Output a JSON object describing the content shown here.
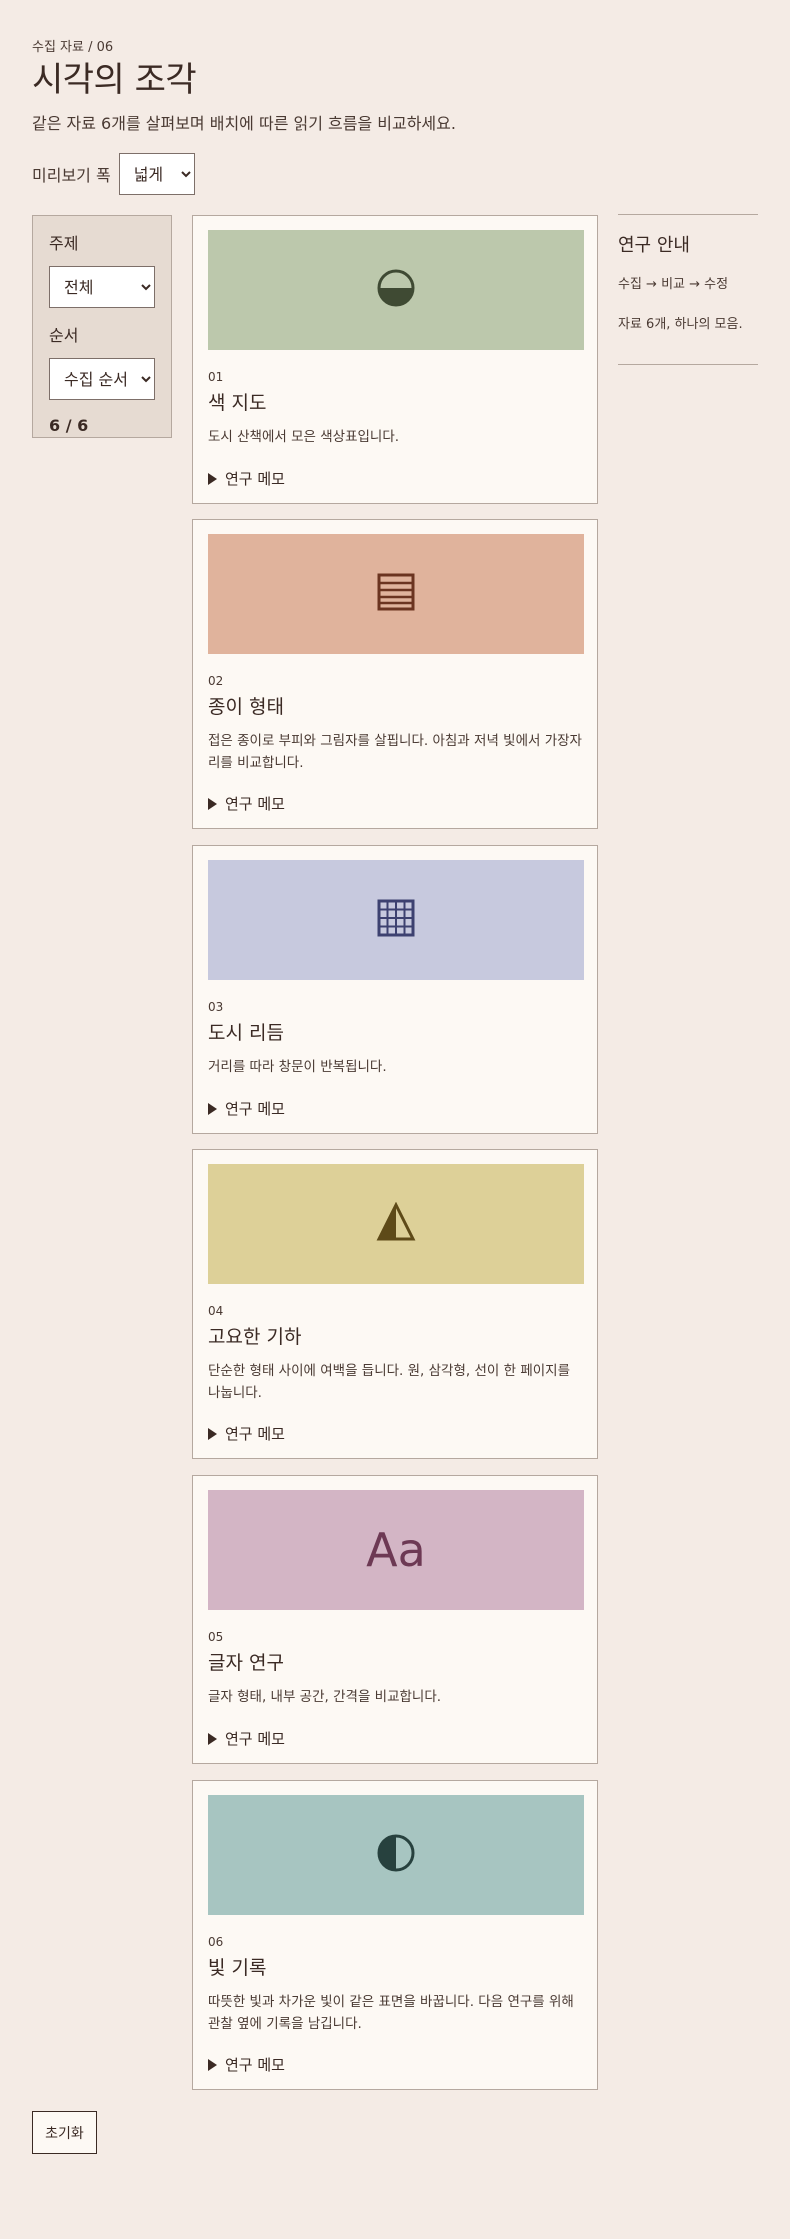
{
  "header": {
    "breadcrumb": "수집 자료 / 06",
    "title": "시각의 조각",
    "subtitle": "같은 자료 6개를 살펴보며 배치에 따른 읽기 흐름을 비교하세요."
  },
  "preview": {
    "label": "미리보기 폭",
    "selected": "넓게"
  },
  "filters": {
    "topic_label": "주제",
    "topic_selected": "전체",
    "order_label": "순서",
    "order_selected": "수집 순서",
    "count": "6 / 6"
  },
  "cards": [
    {
      "num": "01",
      "title": "색 지도",
      "desc": "도시 산책에서 모은 색상표입니다.",
      "memo": "연구 메모",
      "color": "#bcc8ac",
      "icon": "half-filled-circle-icon"
    },
    {
      "num": "02",
      "title": "종이 형태",
      "desc": "접은 종이로 부피와 그림자를 살핍니다. 아침과 저녁 빛에서 가장자리를 비교합니다.",
      "memo": "연구 메모",
      "color": "#e0b39c",
      "icon": "lined-square-icon"
    },
    {
      "num": "03",
      "title": "도시 리듬",
      "desc": "거리를 따라 창문이 반복됩니다.",
      "memo": "연구 메모",
      "color": "#c7c9de",
      "icon": "grid-square-icon"
    },
    {
      "num": "04",
      "title": "고요한 기하",
      "desc": "단순한 형태 사이에 여백을 듭니다. 원, 삼각형, 선이 한 페이지를 나눕니다.",
      "memo": "연구 메모",
      "color": "#ddd098",
      "icon": "half-triangle-icon"
    },
    {
      "num": "05",
      "title": "글자 연구",
      "desc": "글자 형태, 내부 공간, 간격을 비교합니다.",
      "memo": "연구 메모",
      "color": "#d3b5c5",
      "icon": "aa-glyph",
      "glyph": "Aa"
    },
    {
      "num": "06",
      "title": "빛 기록",
      "desc": "따뜻한 빛과 차가운 빛이 같은 표면을 바꿉니다. 다음 연구를 위해 관찰 옆에 기록을 남깁니다.",
      "memo": "연구 메모",
      "color": "#a7c5c1",
      "icon": "half-circle-icon"
    }
  ],
  "aside": {
    "title": "연구 안내",
    "flow": "수집 → 비교 → 수정",
    "note": "자료 6개, 하나의 모음."
  },
  "reset_label": "초기화"
}
